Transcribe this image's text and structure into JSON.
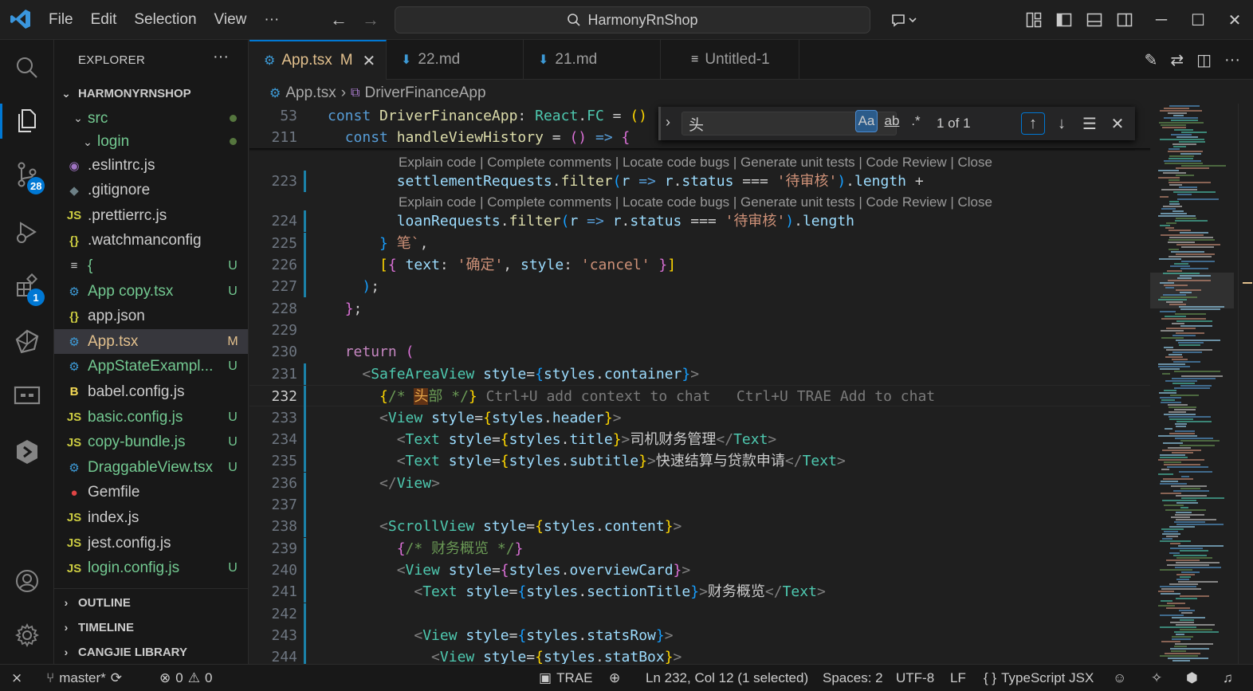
{
  "menu": [
    "File",
    "Edit",
    "Selection",
    "View",
    "···"
  ],
  "search": {
    "text": "HarmonyRnShop"
  },
  "activity": {
    "scm_badge": "28",
    "ext_badge": "1"
  },
  "explorer": {
    "title": "EXPLORER",
    "more": "···",
    "root": "HARMONYRNSHOP",
    "items": [
      {
        "name": "src",
        "icon": "",
        "status": "",
        "indent": 1
      },
      {
        "name": "login",
        "icon": "",
        "status": "",
        "indent": 2
      },
      {
        "name": ".eslintrc.js",
        "icon": "◉",
        "status": "",
        "color": "#cccccc"
      },
      {
        "name": ".gitignore",
        "icon": "◆",
        "status": "",
        "color": "#cccccc"
      },
      {
        "name": ".prettierrc.js",
        "icon": "JS",
        "status": "",
        "color": "#cccccc"
      },
      {
        "name": ".watchmanconfig",
        "icon": "{}",
        "status": "",
        "color": "#cccccc"
      },
      {
        "name": "{",
        "icon": "≡",
        "status": "U",
        "color": "#73c991"
      },
      {
        "name": "App copy.tsx",
        "icon": "⚙",
        "status": "U",
        "color": "#73c991"
      },
      {
        "name": "app.json",
        "icon": "{}",
        "status": "",
        "color": "#cccccc"
      },
      {
        "name": "App.tsx",
        "icon": "⚙",
        "status": "M",
        "color": "#e2c08d"
      },
      {
        "name": "AppStateExampl...",
        "icon": "⚙",
        "status": "U",
        "color": "#73c991"
      },
      {
        "name": "babel.config.js",
        "icon": "B",
        "status": "",
        "color": "#cccccc"
      },
      {
        "name": "basic.config.js",
        "icon": "JS",
        "status": "U",
        "color": "#73c991"
      },
      {
        "name": "copy-bundle.js",
        "icon": "JS",
        "status": "U",
        "color": "#73c991"
      },
      {
        "name": "DraggableView.tsx",
        "icon": "⚙",
        "status": "U",
        "color": "#73c991"
      },
      {
        "name": "Gemfile",
        "icon": "●",
        "status": "",
        "color": "#cccccc"
      },
      {
        "name": "index.js",
        "icon": "JS",
        "status": "",
        "color": "#cccccc"
      },
      {
        "name": "jest.config.js",
        "icon": "JS",
        "status": "",
        "color": "#cccccc"
      },
      {
        "name": "login.config.js",
        "icon": "JS",
        "status": "U",
        "color": "#73c991"
      }
    ],
    "sections": [
      "OUTLINE",
      "TIMELINE",
      "CANGJIE LIBRARY"
    ]
  },
  "tabs": [
    {
      "label": "App.tsx",
      "suffix": "M",
      "icon": "⚙"
    },
    {
      "label": "22.md",
      "icon": "⬇"
    },
    {
      "label": "21.md",
      "icon": "⬇"
    },
    {
      "label": "Untitled-1",
      "icon": "≡"
    }
  ],
  "breadcrumb": {
    "file": "App.tsx",
    "symbol": "DriverFinanceApp"
  },
  "find": {
    "query": "头",
    "case": "Aa",
    "word": "ab",
    "regex": ".*",
    "count": "1 of 1"
  },
  "lens": "Explain code | Complete comments | Locate code bugs | Generate unit tests | Code Review | Close",
  "hint": {
    "ctrl_u": "Ctrl+U add context to chat",
    "trae": "Ctrl+U TRAE Add to chat"
  },
  "code": {
    "l53": "53",
    "l211": "211",
    "l223": "223",
    "l224": "224",
    "l225": "225",
    "l226": "226",
    "l227": "227",
    "l228": "228",
    "l229": "229",
    "l230": "230",
    "l231": "231",
    "l232": "232",
    "l233": "233",
    "l234": "234",
    "l235": "235",
    "l236": "236",
    "l237": "237",
    "l238": "238",
    "l239": "239",
    "l240": "240",
    "l241": "241",
    "l242": "242",
    "l243": "243",
    "l244": "244"
  },
  "text": {
    "pending": "待审核",
    "bi": "笔",
    "confirm": "确定",
    "head": "头",
    "bu": "部",
    "title_cn": "司机财务管理",
    "subtitle_cn": "快速结算与贷款申请",
    "overview_cmt": "财务概览",
    "overview_cn": "财务概览"
  },
  "status": {
    "branch": "master*",
    "errors": "0",
    "warnings": "0",
    "trae": "TRAE",
    "position": "Ln 232, Col 12 (1 selected)",
    "spaces": "Spaces: 2",
    "encoding": "UTF-8",
    "eol": "LF",
    "language": "TypeScript JSX"
  }
}
